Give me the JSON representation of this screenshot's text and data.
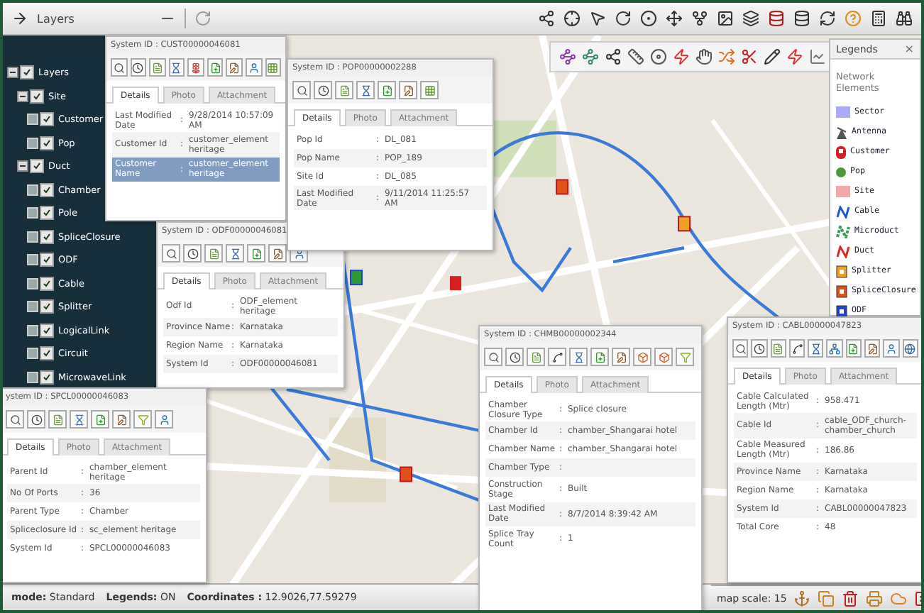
{
  "toolbar": {
    "title": "Layers"
  },
  "layers": {
    "items": [
      {
        "label": "Layers",
        "checked": true,
        "expanded": true,
        "children": [
          {
            "label": "Site",
            "checked": true,
            "expanded": true,
            "children": [
              {
                "label": "Customer",
                "checked": true
              },
              {
                "label": "Pop",
                "checked": true
              }
            ]
          },
          {
            "label": "Duct",
            "checked": true,
            "expanded": true,
            "children": [
              {
                "label": "Chamber",
                "checked": true
              },
              {
                "label": "Pole",
                "checked": true
              },
              {
                "label": "SpliceClosure",
                "checked": true
              },
              {
                "label": "ODF",
                "checked": true
              },
              {
                "label": "Cable",
                "checked": true
              },
              {
                "label": "Splitter",
                "checked": true
              },
              {
                "label": "LogicalLink",
                "checked": true
              },
              {
                "label": "Circuit",
                "checked": true
              },
              {
                "label": "MicrowaveLink",
                "checked": true
              }
            ]
          }
        ]
      }
    ]
  },
  "popups": [
    {
      "title": "System ID : CUST00000046081",
      "tabs": [
        {
          "label": "Details",
          "selected": true
        },
        {
          "label": "Photo",
          "selected": false
        },
        {
          "label": "Attachment",
          "selected": false
        }
      ],
      "rows": [
        {
          "label": "Last Modified Date",
          "sep": ":",
          "value": "9/28/2014 10:57:09 AM",
          "selected": false
        },
        {
          "label": "Customer Id",
          "sep": ":",
          "value": "customer_element heritage",
          "selected": false
        },
        {
          "label": "Customer Name",
          "sep": ":",
          "value": "customer_element heritage",
          "selected": true
        }
      ]
    },
    {
      "title": "System ID : POP00000002288",
      "tabs": [
        {
          "label": "Details",
          "selected": true
        },
        {
          "label": "Photo",
          "selected": false
        },
        {
          "label": "Attachment",
          "selected": false
        }
      ],
      "rows": [
        {
          "label": "Pop Id",
          "sep": ":",
          "value": "DL_081"
        },
        {
          "label": "Pop Name",
          "sep": ":",
          "value": "POP_189"
        },
        {
          "label": "Site Id",
          "sep": ":",
          "value": "DL_085"
        },
        {
          "label": "Last Modified Date",
          "sep": ":",
          "value": "9/11/2014 11:25:57 AM"
        }
      ]
    },
    {
      "title": "System ID : ODF00000046081",
      "tabs": [
        {
          "label": "Details",
          "selected": true
        },
        {
          "label": "Photo",
          "selected": false
        },
        {
          "label": "Attachment",
          "selected": false
        }
      ],
      "rows": [
        {
          "label": "Odf Id",
          "sep": ":",
          "value": "ODF_element heritage"
        },
        {
          "label": "Province Name",
          "sep": ":",
          "value": "Karnataka"
        },
        {
          "label": "Region Name",
          "sep": ":",
          "value": "Karnataka"
        },
        {
          "label": "System Id",
          "sep": ":",
          "value": "ODF00000046081"
        }
      ]
    },
    {
      "title": "ystem ID : SPCL00000046083",
      "tabs": [
        {
          "label": "Details",
          "selected": true
        },
        {
          "label": "Photo",
          "selected": false
        },
        {
          "label": "Attachment",
          "selected": false
        }
      ],
      "rows": [
        {
          "label": "Parent Id",
          "sep": ":",
          "value": "chamber_element heritage"
        },
        {
          "label": "No Of Ports",
          "sep": ":",
          "value": "36"
        },
        {
          "label": "Parent Type",
          "sep": ":",
          "value": "Chamber"
        },
        {
          "label": "Spliceclosure Id",
          "sep": ":",
          "value": "sc_element heritage"
        },
        {
          "label": "System Id",
          "sep": ":",
          "value": "SPCL00000046083"
        }
      ]
    },
    {
      "title": "System ID : CHMB00000002344",
      "tabs": [
        {
          "label": "Details",
          "selected": true
        },
        {
          "label": "Photo",
          "selected": false
        },
        {
          "label": "Attachment",
          "selected": false
        }
      ],
      "rows": [
        {
          "label": "Chamber Closure Type",
          "sep": ":",
          "value": "Splice closure"
        },
        {
          "label": "Chamber Id",
          "sep": ":",
          "value": "chamber_Shangarai hotel"
        },
        {
          "label": "Chamber Name",
          "sep": ":",
          "value": "chamber_Shangarai hotel"
        },
        {
          "label": "Chamber Type",
          "sep": ":"
        },
        {
          "label": "Construction Stage",
          "sep": ":",
          "value": "Built"
        },
        {
          "label": "Last Modified Date",
          "sep": ":",
          "value": "8/7/2014 8:39:42 AM"
        },
        {
          "label": "Splice Tray Count",
          "sep": ":",
          "value": "1"
        }
      ]
    },
    {
      "title": "System ID : CABL00000047823",
      "tabs": [
        {
          "label": "Details",
          "selected": true
        },
        {
          "label": "Photo",
          "selected": false
        },
        {
          "label": "Attachment",
          "selected": false
        }
      ],
      "rows": [
        {
          "label": "Cable Calculated Length (Mtr)",
          "sep": ":",
          "value": "958.471"
        },
        {
          "label": "Cable Id",
          "sep": ":",
          "value": "cable_ODF_church-chamber_church"
        },
        {
          "label": "Cable Measured Length (Mtr)",
          "sep": ":",
          "value": "186.86"
        },
        {
          "label": "Province Name",
          "sep": ":",
          "value": "Karnataka"
        },
        {
          "label": "Region Name",
          "sep": ":",
          "value": "Karnataka"
        },
        {
          "label": "System Id",
          "sep": ":",
          "value": "CABL00000047823"
        },
        {
          "label": "Total Core",
          "sep": ":",
          "value": "48"
        }
      ]
    }
  ],
  "legend": {
    "title": "Legends",
    "close": "×",
    "heading": "Network Elements",
    "items": [
      {
        "label": "Sector",
        "kind": "swatch",
        "color": "#a9a9f5"
      },
      {
        "label": "Antenna",
        "kind": "antenna",
        "color": "#555555"
      },
      {
        "label": "Customer",
        "kind": "pin",
        "color": "#d42020"
      },
      {
        "label": "Pop",
        "kind": "dot",
        "color": "#4a9a3a"
      },
      {
        "label": "Site",
        "kind": "swatch",
        "color": "#f2a8a8"
      },
      {
        "label": "Cable",
        "kind": "line",
        "color": "#2256d8"
      },
      {
        "label": "Microduct",
        "kind": "dashed",
        "color": "#3a9a5a"
      },
      {
        "label": "Duct",
        "kind": "line",
        "color": "#d82a2a"
      },
      {
        "label": "Splitter",
        "kind": "box",
        "color": "#f0a020"
      },
      {
        "label": "SpliceClosure",
        "kind": "box",
        "color": "#e0501a"
      },
      {
        "label": "ODF",
        "kind": "box",
        "color": "#2244cc"
      }
    ]
  },
  "status_bar": {
    "items": [
      {
        "label": "mode:",
        "value": "Standard"
      },
      {
        "label": "Legends:",
        "value": "ON"
      },
      {
        "label": "Coordinates :",
        "value": "12.9026,77.59279"
      }
    ],
    "map_scale": "map scale: 15"
  }
}
